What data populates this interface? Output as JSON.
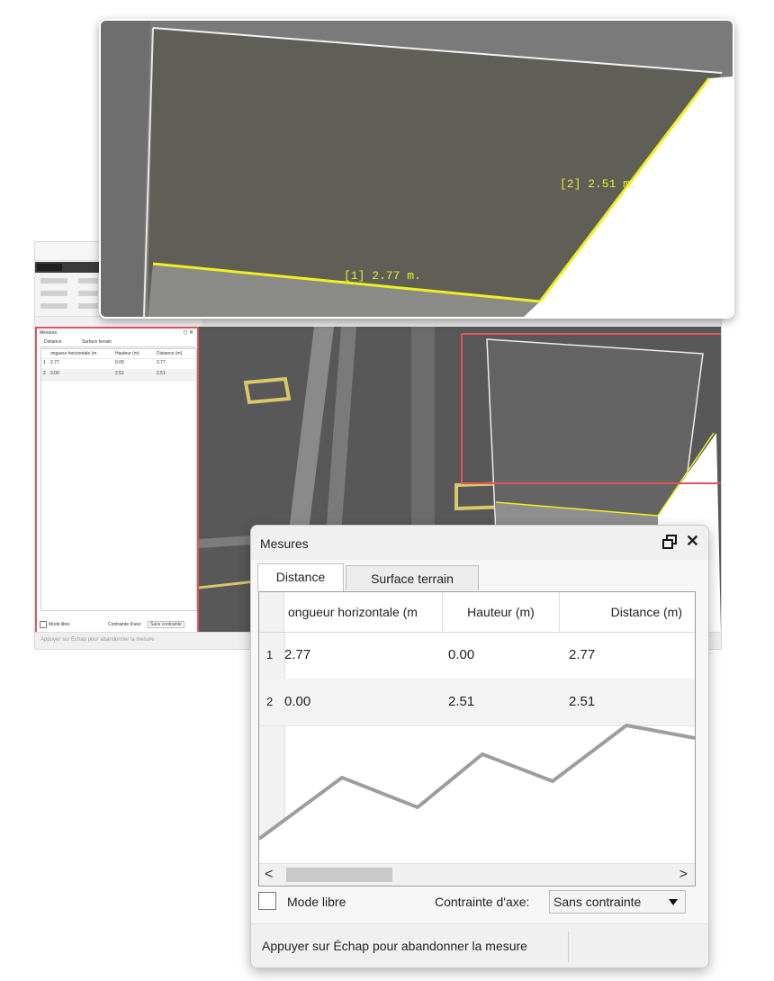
{
  "colors": {
    "measure_line": "#f0f020",
    "highlight_border": "#e0565b",
    "viewport_dark": "#565656"
  },
  "zoom_top": {
    "label_1": "[1]  2.77 m.",
    "label_2": "[2]  2.51 m."
  },
  "mesures": {
    "title": "Mesures",
    "float_icon": "restore-window-icon",
    "close_label": "✕",
    "tabs": [
      {
        "label": "Distance",
        "active": true
      },
      {
        "label": "Surface terrain",
        "active": false
      }
    ],
    "columns": [
      "ongueur horizontale (m",
      "Hauteur (m)",
      "Distance (m)"
    ],
    "rows": [
      {
        "index": "1",
        "horizontal": "2.77",
        "height": "0.00",
        "distance": "2.77"
      },
      {
        "index": "2",
        "horizontal": "0.00",
        "height": "2.51",
        "distance": "2.51"
      }
    ],
    "scroll_left": "<",
    "scroll_right": ">",
    "free_mode_label": "Mode libre",
    "axis_constraint_label": "Contrainte d'axe:",
    "axis_constraint_value": "Sans contrainte",
    "status_text": "Appuyer sur Échap pour abandonner la mesure"
  }
}
